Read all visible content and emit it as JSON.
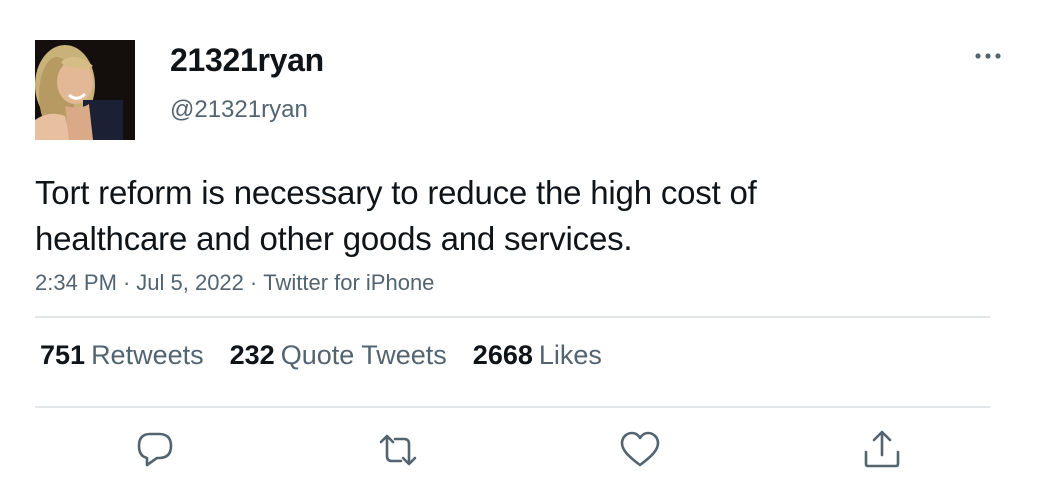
{
  "user": {
    "display_name": "21321ryan",
    "handle": "@21321ryan",
    "avatar": "profile-photo"
  },
  "tweet": {
    "text_line1": "Tort reform is necessary to reduce the high cost of",
    "text_line2": "healthcare and other goods and services.",
    "time": "2:34 PM",
    "date": "Jul 5, 2022",
    "source": "Twitter for iPhone",
    "separator": "·"
  },
  "stats": {
    "retweets_count": "751",
    "retweets_label": "Retweets",
    "quotes_count": "232",
    "quotes_label": "Quote Tweets",
    "likes_count": "2668",
    "likes_label": "Likes"
  },
  "icons": {
    "more": "more-icon",
    "reply": "reply-icon",
    "retweet": "retweet-icon",
    "like": "heart-icon",
    "share": "share-icon"
  },
  "colors": {
    "text_primary": "#0f1419",
    "text_secondary": "#536471",
    "divider": "#e3e7ea",
    "icon": "#536471"
  }
}
